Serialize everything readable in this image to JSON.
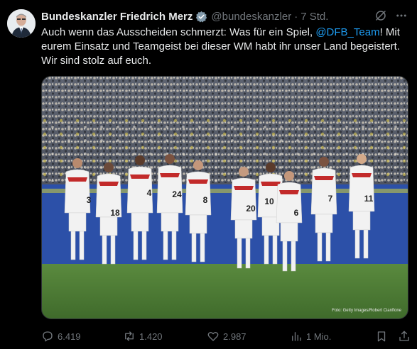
{
  "author": {
    "name": "Bundeskanzler Friedrich Merz",
    "handle": "@bundeskanzler",
    "separator": "·",
    "time": "7 Std."
  },
  "tweet": {
    "text_before": "Auch wenn das Ausscheiden schmerzt: Was für ein Spiel, ",
    "mention": "@DFB_Team",
    "text_after": "! Mit eurem Einsatz und Teamgeist bei dieser WM habt ihr unser Land begeistert. Wir sind stolz auf euch."
  },
  "media": {
    "credit": "Foto: Getty Images/Robert Cianflone",
    "player_numbers": [
      "3",
      "18",
      "4",
      "24",
      "8",
      "20",
      "10",
      "6",
      "7",
      "11"
    ]
  },
  "actions": {
    "replies": "6.419",
    "reposts": "1.420",
    "likes": "2.987",
    "views": "1 Mio."
  },
  "colors": {
    "background": "#000000",
    "text": "#e7e9ea",
    "muted": "#71767b",
    "link": "#1d9bf0",
    "verified": "#829aab"
  }
}
